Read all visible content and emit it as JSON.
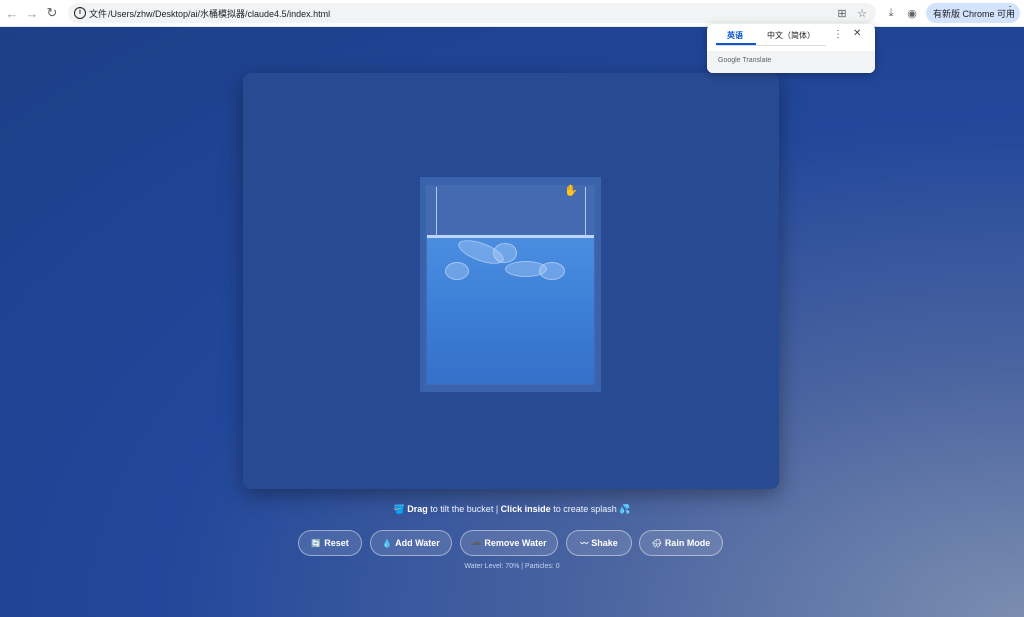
{
  "browser": {
    "info_label": "文件",
    "url": "/Users/zhw/Desktop/ai/水桶模拟器/claude4.5/index.html",
    "update_label": "有新版 Chrome 可用"
  },
  "translate_popup": {
    "tab_source": "英语",
    "tab_target": "中文（简体）",
    "brand": "Google Translate"
  },
  "hint": {
    "drag_bold": "Drag",
    "drag_text": " to tilt the bucket | ",
    "click_bold": "Click inside",
    "click_text": " to create splash "
  },
  "controls": [
    {
      "icon": "🔄",
      "label": "Reset"
    },
    {
      "icon": "💧",
      "label": "Add Water"
    },
    {
      "icon": "➖",
      "label": "Remove Water"
    },
    {
      "icon": "〰",
      "label": "Shake"
    },
    {
      "icon": "🌧",
      "label": "Rain Mode"
    }
  ],
  "status": "Water Level: 70% | Particles: 0",
  "water_level_fraction": 0.7
}
